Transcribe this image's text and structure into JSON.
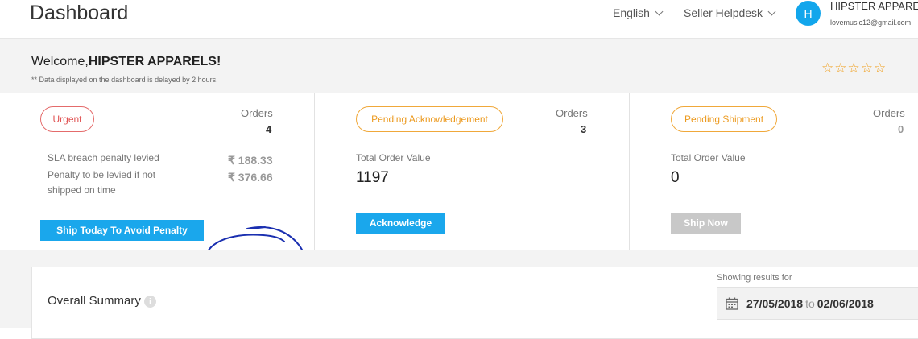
{
  "header": {
    "title": "Dashboard",
    "language": "English",
    "helpdesk": "Seller Helpdesk",
    "avatar_initial": "H",
    "user_name": "HIPSTER APPARELS",
    "user_email": "lovemusic12@gmail.com"
  },
  "welcome": {
    "prefix": "Welcome,",
    "name": "HIPSTER APPARELS!",
    "note": "** Data displayed on the dashboard is delayed by 2 hours.",
    "stars": "☆☆☆☆☆",
    "rating_filled": 0,
    "rating_max": 5
  },
  "cards": {
    "urgent": {
      "label": "Urgent",
      "orders_label": "Orders",
      "orders_value": "4",
      "sla_label": "SLA breach penalty levied",
      "sla_value": "₹ 188.33",
      "penalty_label": "Penalty to be levied if not shipped on time",
      "penalty_value": "₹ 376.66",
      "button": "Ship Today To Avoid Penalty"
    },
    "pending_ack": {
      "label": "Pending Acknowledgement",
      "orders_label": "Orders",
      "orders_value": "3",
      "value_label": "Total Order Value",
      "value": "1197",
      "button": "Acknowledge"
    },
    "pending_ship": {
      "label": "Pending Shipment",
      "orders_label": "Orders",
      "orders_value": "0",
      "value_label": "Total Order Value",
      "value": "0",
      "button": "Ship Now"
    }
  },
  "summary": {
    "title": "Overall Summary",
    "info": "i",
    "showing_label": "Showing results for",
    "date_from": "27/05/2018",
    "date_to_word": "to",
    "date_to": "02/06/2018"
  },
  "colors": {
    "accent": "#1aa7ec",
    "urgent": "#e05353",
    "pending": "#ec9a1f",
    "annotation": "#1a2fb0"
  }
}
